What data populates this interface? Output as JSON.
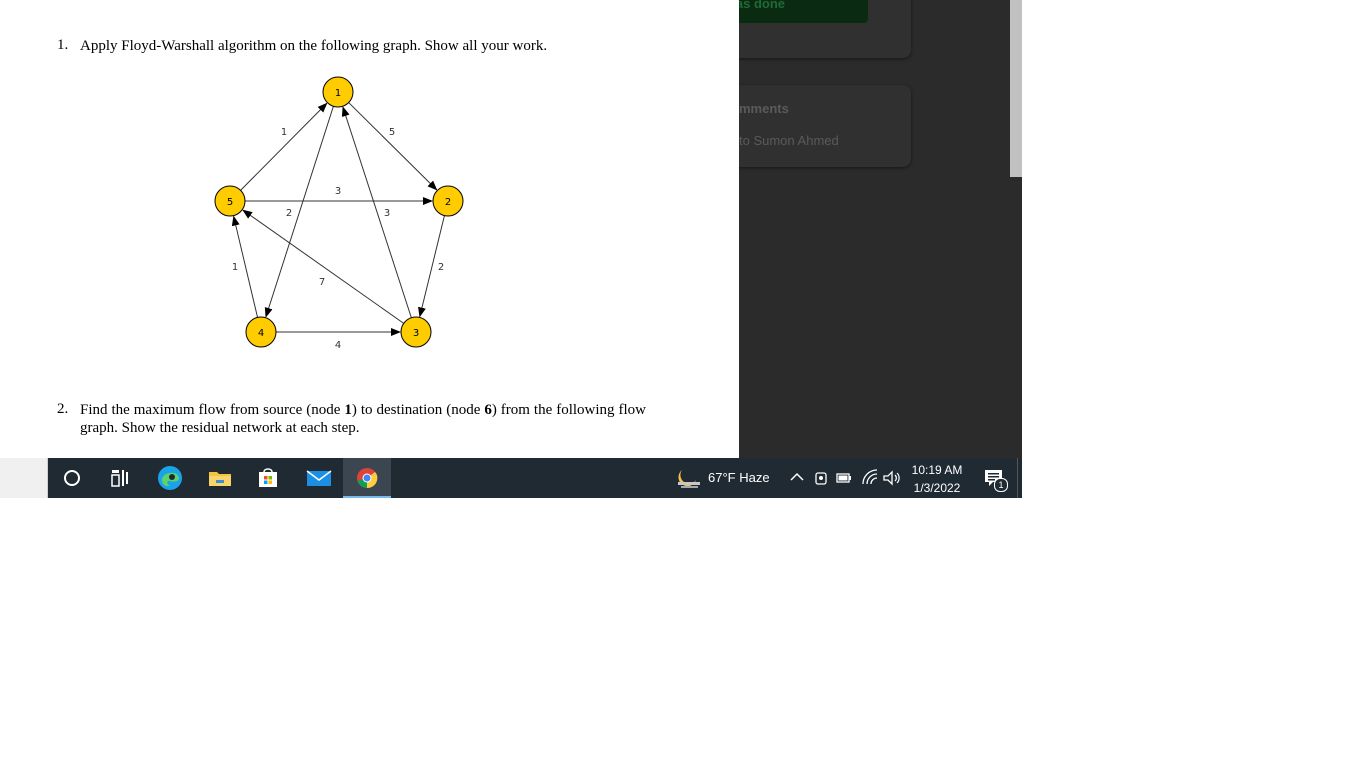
{
  "document": {
    "q1": {
      "number": "1.",
      "text": "Apply Floyd-Warshall algorithm on the following graph. Show all your work."
    },
    "graph": {
      "nodes": [
        {
          "id": "1",
          "label": "1"
        },
        {
          "id": "2",
          "label": "2"
        },
        {
          "id": "3",
          "label": "3"
        },
        {
          "id": "4",
          "label": "4"
        },
        {
          "id": "5",
          "label": "5"
        }
      ],
      "edges": [
        {
          "from": "5",
          "to": "1",
          "weight": "1"
        },
        {
          "from": "1",
          "to": "2",
          "weight": "5"
        },
        {
          "from": "5",
          "to": "2",
          "weight": "3"
        },
        {
          "from": "1",
          "to": "4",
          "weight": "2"
        },
        {
          "from": "3",
          "to": "1",
          "weight": "3"
        },
        {
          "from": "2",
          "to": "3",
          "weight": "2"
        },
        {
          "from": "4",
          "to": "5",
          "weight": "1"
        },
        {
          "from": "3",
          "to": "5",
          "weight": "7"
        },
        {
          "from": "4",
          "to": "3",
          "weight": "4"
        }
      ],
      "node_fill": "#ffcc00",
      "node_stroke": "#000000"
    },
    "q2": {
      "number": "2.",
      "text_before_source": "Find the maximum flow from source (node ",
      "source": "1",
      "text_between": ") to destination (node ",
      "destination": "6",
      "text_after": ") from the following flow graph. Show the residual network at each step."
    }
  },
  "side_panel": {
    "mark_done_label": "rk as done",
    "comments_title": "mments",
    "add_comment_label": "to Sumon Ahmed"
  },
  "taskbar": {
    "apps": [
      {
        "name": "cortana",
        "icon": "circle-icon"
      },
      {
        "name": "task-view",
        "icon": "task-view-icon"
      },
      {
        "name": "edge",
        "icon": "edge-icon"
      },
      {
        "name": "file-explorer",
        "icon": "folder-icon"
      },
      {
        "name": "store",
        "icon": "store-icon"
      },
      {
        "name": "mail",
        "icon": "mail-icon"
      },
      {
        "name": "chrome",
        "icon": "chrome-icon",
        "active": true
      }
    ],
    "weather": "67°F  Haze",
    "time": "10:19 AM",
    "date": "1/3/2022",
    "notification_count": "1"
  },
  "colors": {
    "taskbar_bg": "#1f2a33",
    "panel_bg": "#2b2b2b",
    "accent": "#76b9ed"
  }
}
